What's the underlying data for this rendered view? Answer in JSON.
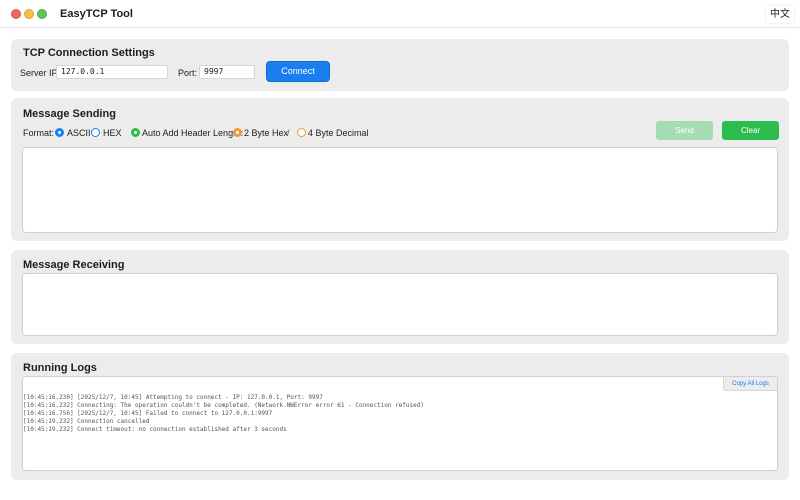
{
  "window": {
    "title": "EasyTCP Tool",
    "language_button": "中文"
  },
  "connection": {
    "title": "TCP Connection Settings",
    "server_ip_label": "Server IP:",
    "server_ip_value": "127.0.0.1",
    "port_label": "Port:",
    "port_value": "9997",
    "connect_label": "Connect"
  },
  "sending": {
    "title": "Message Sending",
    "format_label": "Format:",
    "format_options": [
      "ASCII",
      "HEX"
    ],
    "format_selected": "ASCII",
    "auto_header_label": "Auto Add Header Length:",
    "header_options": [
      "2 Byte Hex",
      "4 Byte Decimal"
    ],
    "header_selected": "2 Byte Hex",
    "separator": "/",
    "send_label": "Send",
    "clear_label": "Clear",
    "message_text": ""
  },
  "receiving": {
    "title": "Message Receiving",
    "message_text": ""
  },
  "logs": {
    "title": "Running Logs",
    "copy_label": "Copy All Logs",
    "lines": [
      "[10:45:16.230] [2025/12/7, 10:45] Attempting to connect - IP: 127.0.0.1, Port: 9997",
      "[10:45:16.232] Connecting: The operation couldn't be completed. (Network.NWError error 61 - Connection refused)",
      "[10:45:16.756] [2025/12/7, 10:45] Failed to connect to 127.0.0.1:9997",
      "[10:45:19.232] Connection cancelled",
      "[10:45:19.232] Connect timeout: no connection established after 3 seconds"
    ]
  },
  "colors": {
    "accent_blue": "#1b7ef0",
    "success_green": "#2dbd4e",
    "disabled_green": "#a6dcb1",
    "radio_orange": "#f19a3e",
    "panel_bg": "#ececec"
  }
}
